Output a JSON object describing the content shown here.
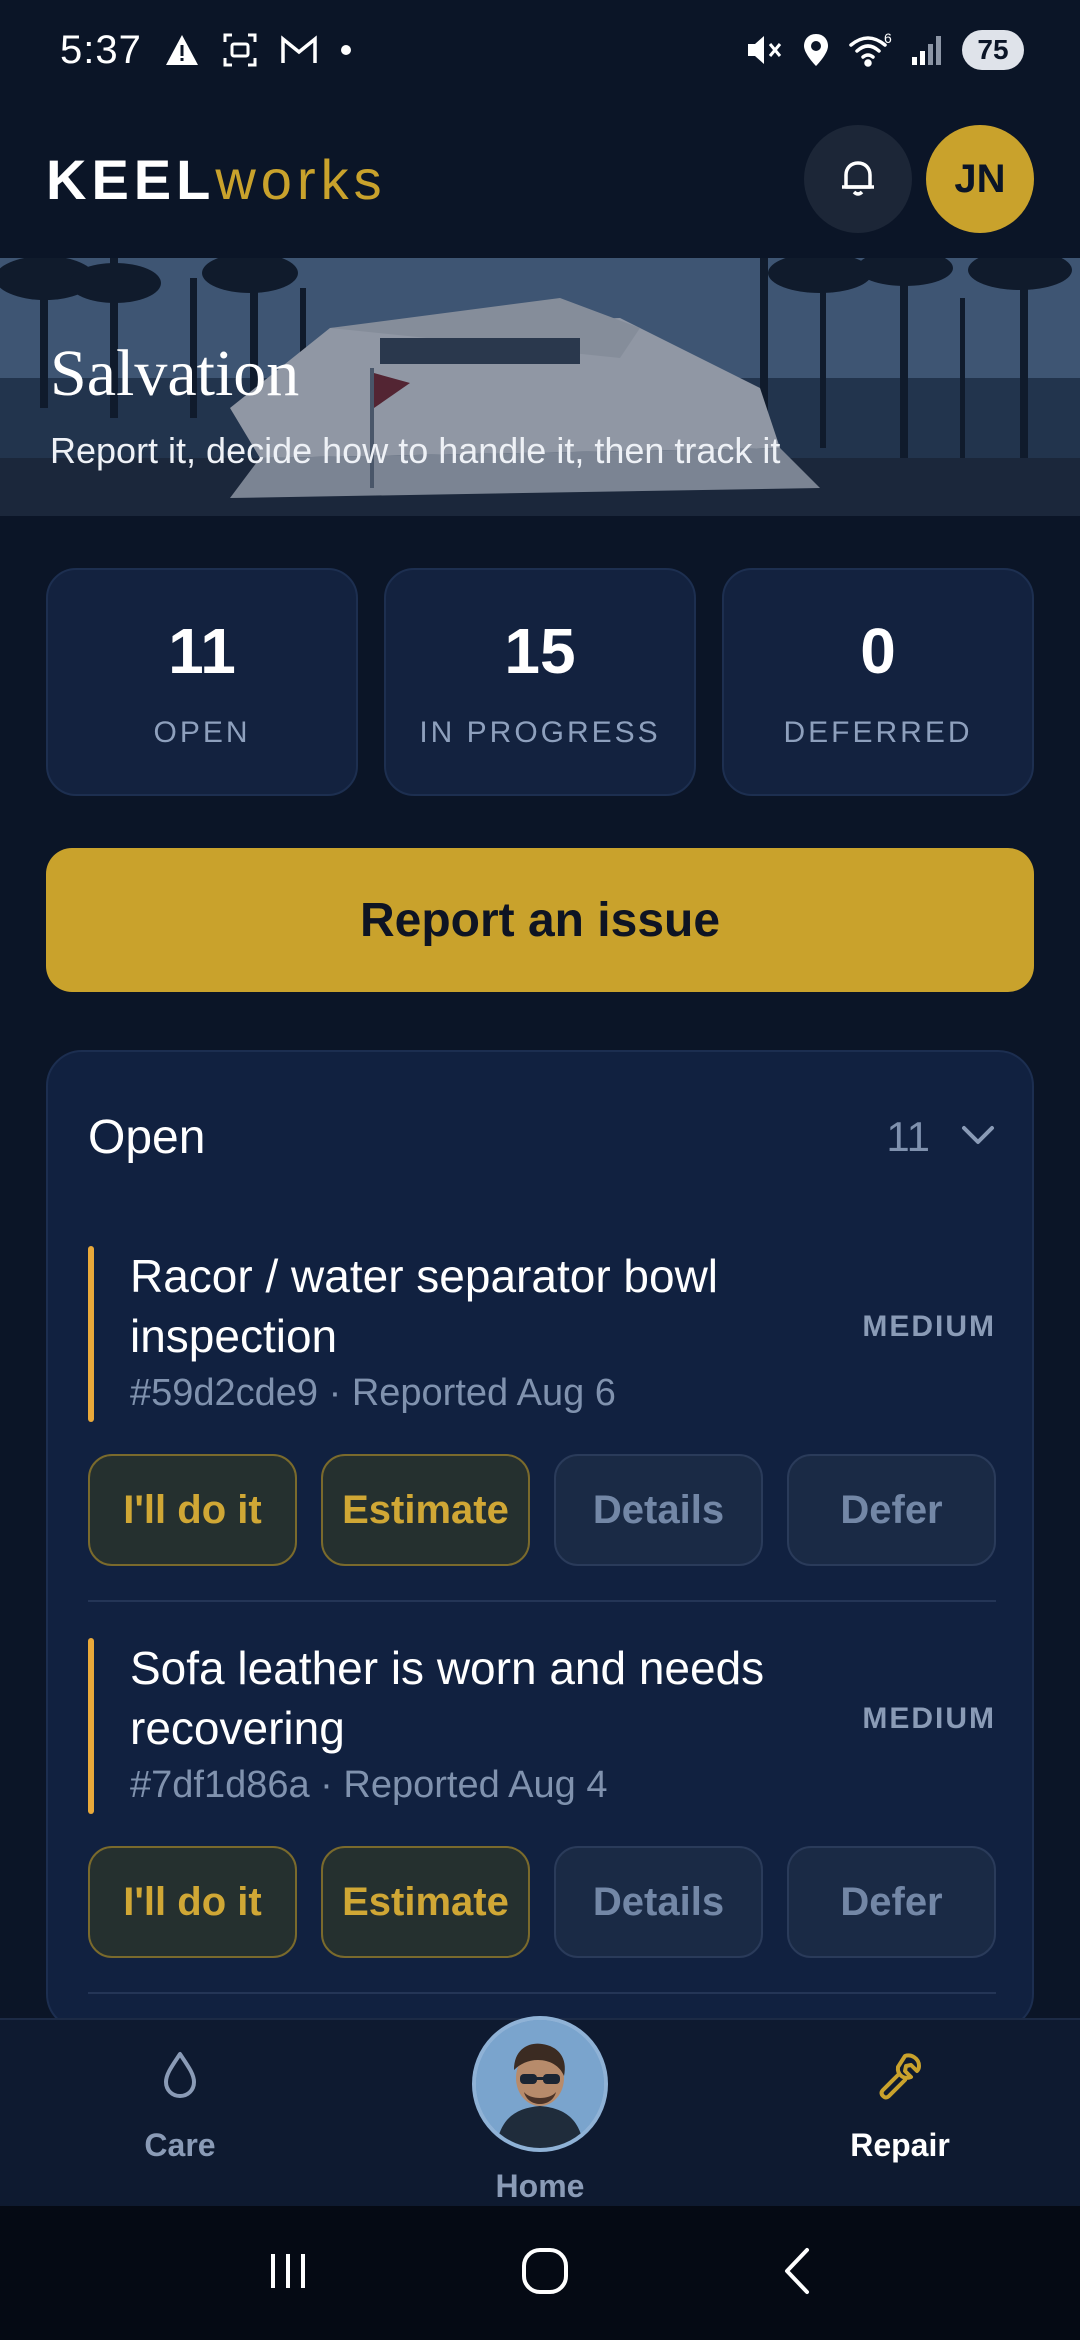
{
  "status_bar": {
    "time": "5:37",
    "battery": "75",
    "signal_label": "6"
  },
  "header": {
    "logo_part1": "KEEL",
    "logo_part2": "works",
    "avatar_initials": "JN"
  },
  "hero": {
    "title": "Salvation",
    "subtitle": "Report it, decide how to handle it, then track it"
  },
  "stats": [
    {
      "value": "11",
      "label": "OPEN"
    },
    {
      "value": "15",
      "label": "IN PROGRESS"
    },
    {
      "value": "0",
      "label": "DEFERRED"
    }
  ],
  "report_button": "Report an issue",
  "open_panel": {
    "title": "Open",
    "count": "11",
    "issues": [
      {
        "title": "Racor / water separator bowl inspection",
        "meta": "#59d2cde9 · Reported Aug 6",
        "severity": "MEDIUM",
        "actions": [
          "I'll do it",
          "Estimate",
          "Details",
          "Defer"
        ]
      },
      {
        "title": "Sofa leather is worn and needs recovering",
        "meta": "#7df1d86a · Reported Aug 4",
        "severity": "MEDIUM",
        "actions": [
          "I'll do it",
          "Estimate",
          "Details",
          "Defer"
        ]
      }
    ]
  },
  "bottom_nav": {
    "care": "Care",
    "home": "Home",
    "repair": "Repair"
  },
  "colors": {
    "background": "#0b1527",
    "accent_gold": "#c9a22c",
    "card": "#13223f",
    "issue_bar": "#e9a93a",
    "muted_text": "#8ea0bd"
  },
  "icons": [
    "alert-icon",
    "screenshot-icon",
    "gmail-icon",
    "mute-icon",
    "location-icon",
    "wifi-icon",
    "signal-icon",
    "bell-icon",
    "chevron-down-icon",
    "droplet-icon",
    "wrench-icon"
  ]
}
